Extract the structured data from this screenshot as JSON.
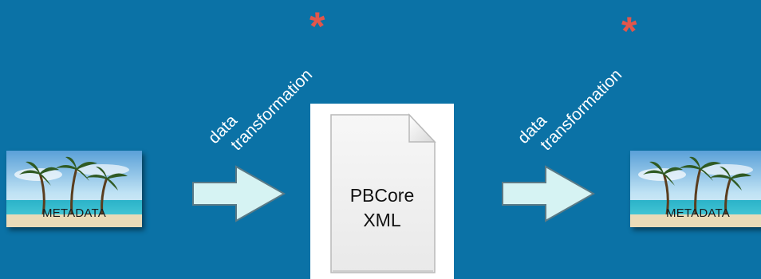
{
  "steps": {
    "source_label": "METADATA",
    "target_label": "METADATA",
    "document": {
      "line1": "PBCore",
      "line2": "XML"
    }
  },
  "transforms": [
    {
      "line1": "data",
      "line2": "transformation",
      "marker": "*"
    },
    {
      "line1": "data",
      "line2": "transformation",
      "marker": "*"
    }
  ],
  "colors": {
    "background": "#0b72a6",
    "arrow_fill": "#d6f3f3",
    "asterisk": "#e2564b",
    "text": "#ffffff"
  },
  "icons": {
    "source": "beach-image-icon",
    "target": "beach-image-icon",
    "document": "document-icon",
    "arrows": "right-arrow-icon"
  }
}
